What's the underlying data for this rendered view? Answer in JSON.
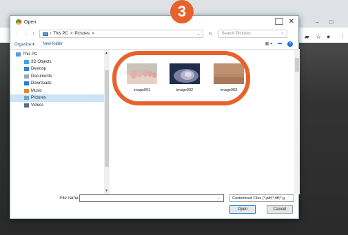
{
  "step_number": "3",
  "dialog": {
    "title": "Open",
    "nav": {
      "breadcrumb": [
        "This PC",
        ">",
        "Pictures",
        ">"
      ],
      "search_placeholder": "Search Pictures"
    },
    "toolbar": {
      "organize": "Organize ▾",
      "new_folder": "New folder"
    },
    "sidebar": [
      {
        "label": "This PC",
        "icon": "computer-icon",
        "level": 0,
        "selected": false
      },
      {
        "label": "3D Objects",
        "icon": "3d-objects-icon",
        "level": 1,
        "selected": false
      },
      {
        "label": "Desktop",
        "icon": "desktop-icon",
        "level": 1,
        "selected": false
      },
      {
        "label": "Documents",
        "icon": "documents-icon",
        "level": 1,
        "selected": false
      },
      {
        "label": "Downloads",
        "icon": "downloads-icon",
        "level": 1,
        "selected": false
      },
      {
        "label": "Music",
        "icon": "music-icon",
        "level": 1,
        "selected": false
      },
      {
        "label": "Pictures",
        "icon": "pictures-icon",
        "level": 1,
        "selected": true
      },
      {
        "label": "Videos",
        "icon": "videos-icon",
        "level": 1,
        "selected": false
      }
    ],
    "files": [
      {
        "name": "image001",
        "subject": "feet photo"
      },
      {
        "name": "image002",
        "subject": "finger nail photo"
      },
      {
        "name": "image003",
        "subject": "skin texture photo"
      }
    ],
    "bottom": {
      "file_name_label": "File name:",
      "file_name_value": "",
      "file_type": "Customised Files (*.pdf;*.tiff;*.g",
      "open_label": "Open",
      "cancel_label": "Cancel"
    }
  },
  "colors": {
    "highlight": "#e8622b",
    "selected_bg": "#cce4f7"
  }
}
